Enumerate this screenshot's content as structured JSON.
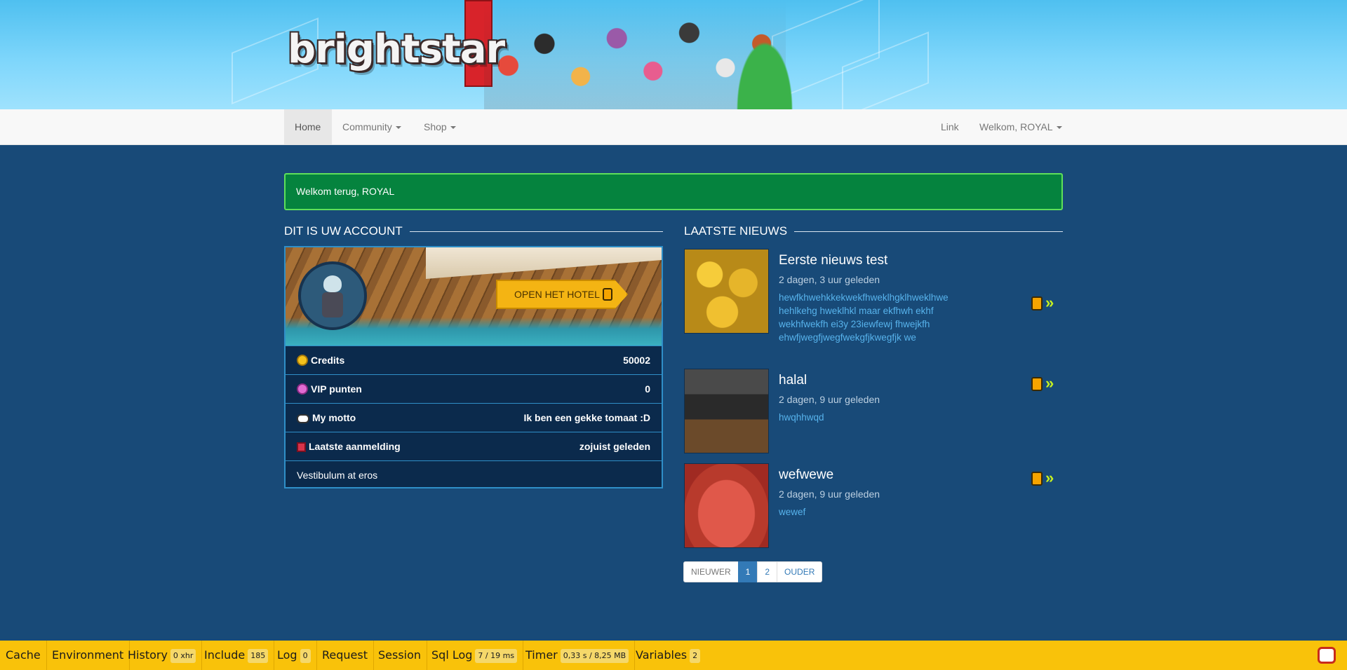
{
  "header": {
    "logo_text": "brightstar"
  },
  "nav": {
    "home": "Home",
    "community": "Community",
    "shop": "Shop",
    "link": "Link",
    "user_menu": "Welkom, ROYAL"
  },
  "alert": {
    "text": "Welkom terug, ROYAL"
  },
  "account": {
    "heading": "DIT IS UW ACCOUNT",
    "open_hotel": "OPEN HET HOTEL",
    "rows": [
      {
        "label": "Credits",
        "value": "50002",
        "icon": "coin-icon"
      },
      {
        "label": "VIP punten",
        "value": "0",
        "icon": "diamond-icon"
      },
      {
        "label": "My motto",
        "value": "Ik ben een gekke tomaat :D",
        "icon": "speech-bubble-icon"
      },
      {
        "label": "Laatste aanmelding",
        "value": "zojuist geleden",
        "icon": "calendar-icon"
      }
    ],
    "footer_text": "Vestibulum at eros"
  },
  "news": {
    "heading": "LAATSTE NIEUWS",
    "items": [
      {
        "title": "Eerste nieuws test",
        "date": "2 dagen, 3 uur geleden",
        "body": "hewfkhwehkkekwekfhweklhgklhweklhwe hehlkehg hweklhkl maar ekfhwh ekhf wekhfwekfh ei3y 23iewfewj fhwejkfh ehwfjwegfjwegfwekgfjkwegfjk we"
      },
      {
        "title": "halal",
        "date": "2 dagen, 9 uur geleden",
        "body": "hwqhhwqd"
      },
      {
        "title": "wefwewe",
        "date": "2 dagen, 9 uur geleden",
        "body": "wewef"
      }
    ]
  },
  "pagination": {
    "newer": "NIEUWER",
    "page1": "1",
    "page2": "2",
    "older": "OUDER"
  },
  "debugbar": {
    "items": [
      {
        "label": "Cache",
        "badge": ""
      },
      {
        "label": "Environment",
        "badge": ""
      },
      {
        "label": "History",
        "badge": "0 xhr"
      },
      {
        "label": "Include",
        "badge": "185"
      },
      {
        "label": "Log",
        "badge": "0"
      },
      {
        "label": "Request",
        "badge": ""
      },
      {
        "label": "Session",
        "badge": ""
      },
      {
        "label": "Sql Log",
        "badge": "7 / 19 ms"
      },
      {
        "label": "Timer",
        "badge": "0,33 s / 8,25 MB"
      },
      {
        "label": "Variables",
        "badge": "2"
      }
    ]
  },
  "colors": {
    "page_bg": "#184a78",
    "alert_bg": "#05833e",
    "debugbar_bg": "#f9c20a",
    "link": "#57b3ec",
    "accent_border": "#2f8fc8"
  }
}
